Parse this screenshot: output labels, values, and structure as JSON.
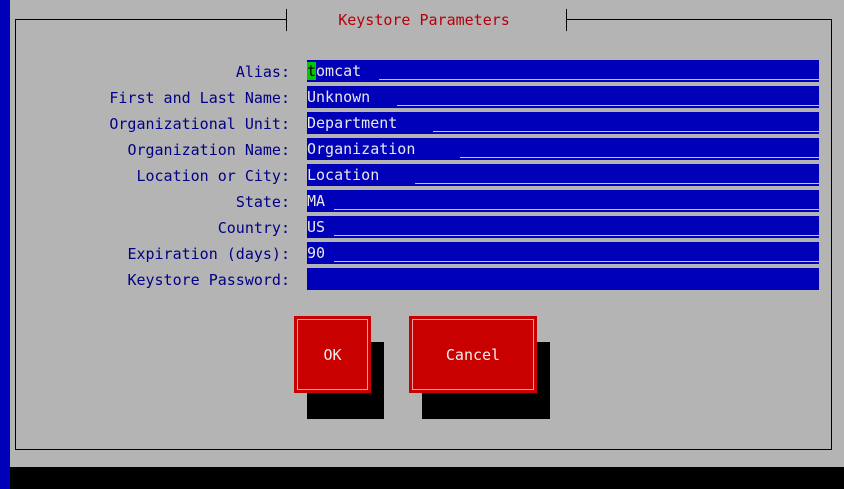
{
  "dialog": {
    "title": "Keystore Parameters",
    "fields": [
      {
        "label": "Alias:",
        "value_first": "t",
        "value_rest": "omcat"
      },
      {
        "label": "First and Last Name:",
        "value": "Unknown"
      },
      {
        "label": "Organizational Unit:",
        "value": "Department"
      },
      {
        "label": "Organization Name:",
        "value": "Organization"
      },
      {
        "label": "Location or City:",
        "value": "Location"
      },
      {
        "label": "State:",
        "value": "MA"
      },
      {
        "label": "Country:",
        "value": "US"
      },
      {
        "label": "Expiration (days):",
        "value": "90"
      },
      {
        "label": "Keystore Password:",
        "value": ""
      }
    ],
    "ok_label": "OK",
    "cancel_label": "Cancel"
  },
  "colors": {
    "background": "#b4b4b4",
    "field_background": "#0000b8",
    "label_text": "#000084",
    "title_text": "#b4000c",
    "button": "#c80000",
    "cursor": "#00c800"
  }
}
